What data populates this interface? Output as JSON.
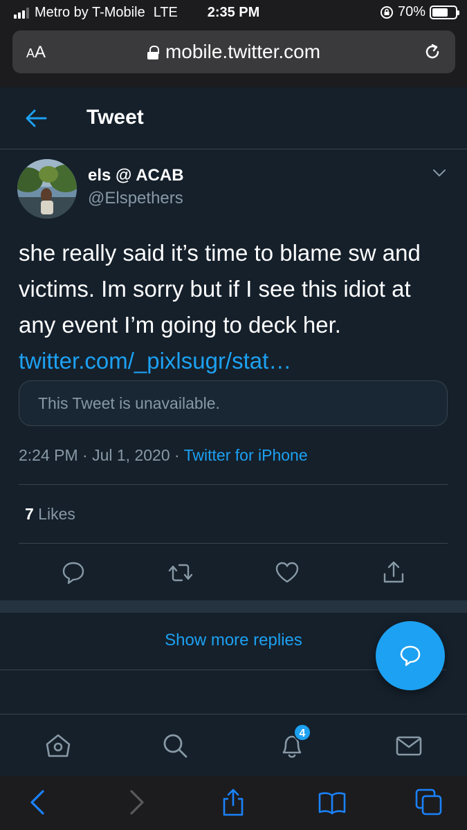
{
  "status_bar": {
    "carrier": "Metro by T-Mobile",
    "network": "LTE",
    "time": "2:35 PM",
    "battery": "70%",
    "battery_level": 0.7
  },
  "browser": {
    "text_size_label_small": "A",
    "text_size_label_large": "A",
    "url": "mobile.twitter.com"
  },
  "header": {
    "title": "Tweet"
  },
  "tweet": {
    "author_name": "els @ ACAB",
    "author_handle": "@Elspethers",
    "text": "she really said it’s time to blame sw and victims. Im sorry but if I see this idiot at any event I’m going to deck her. ",
    "link_text": "twitter.com/_pixlsugr/stat…",
    "quoted_unavailable": "This Tweet is unavailable.",
    "timestamp": "2:24 PM · Jul 1, 2020 · ",
    "source": "Twitter for iPhone",
    "likes_count": "7",
    "likes_label": " Likes"
  },
  "replies": {
    "show_more": "Show more replies"
  },
  "tabbar": {
    "notifications_badge": "4"
  },
  "colors": {
    "background": "#15202b",
    "accent": "#1da1f2",
    "secondary_text": "#8899a6",
    "border": "#38444d"
  }
}
